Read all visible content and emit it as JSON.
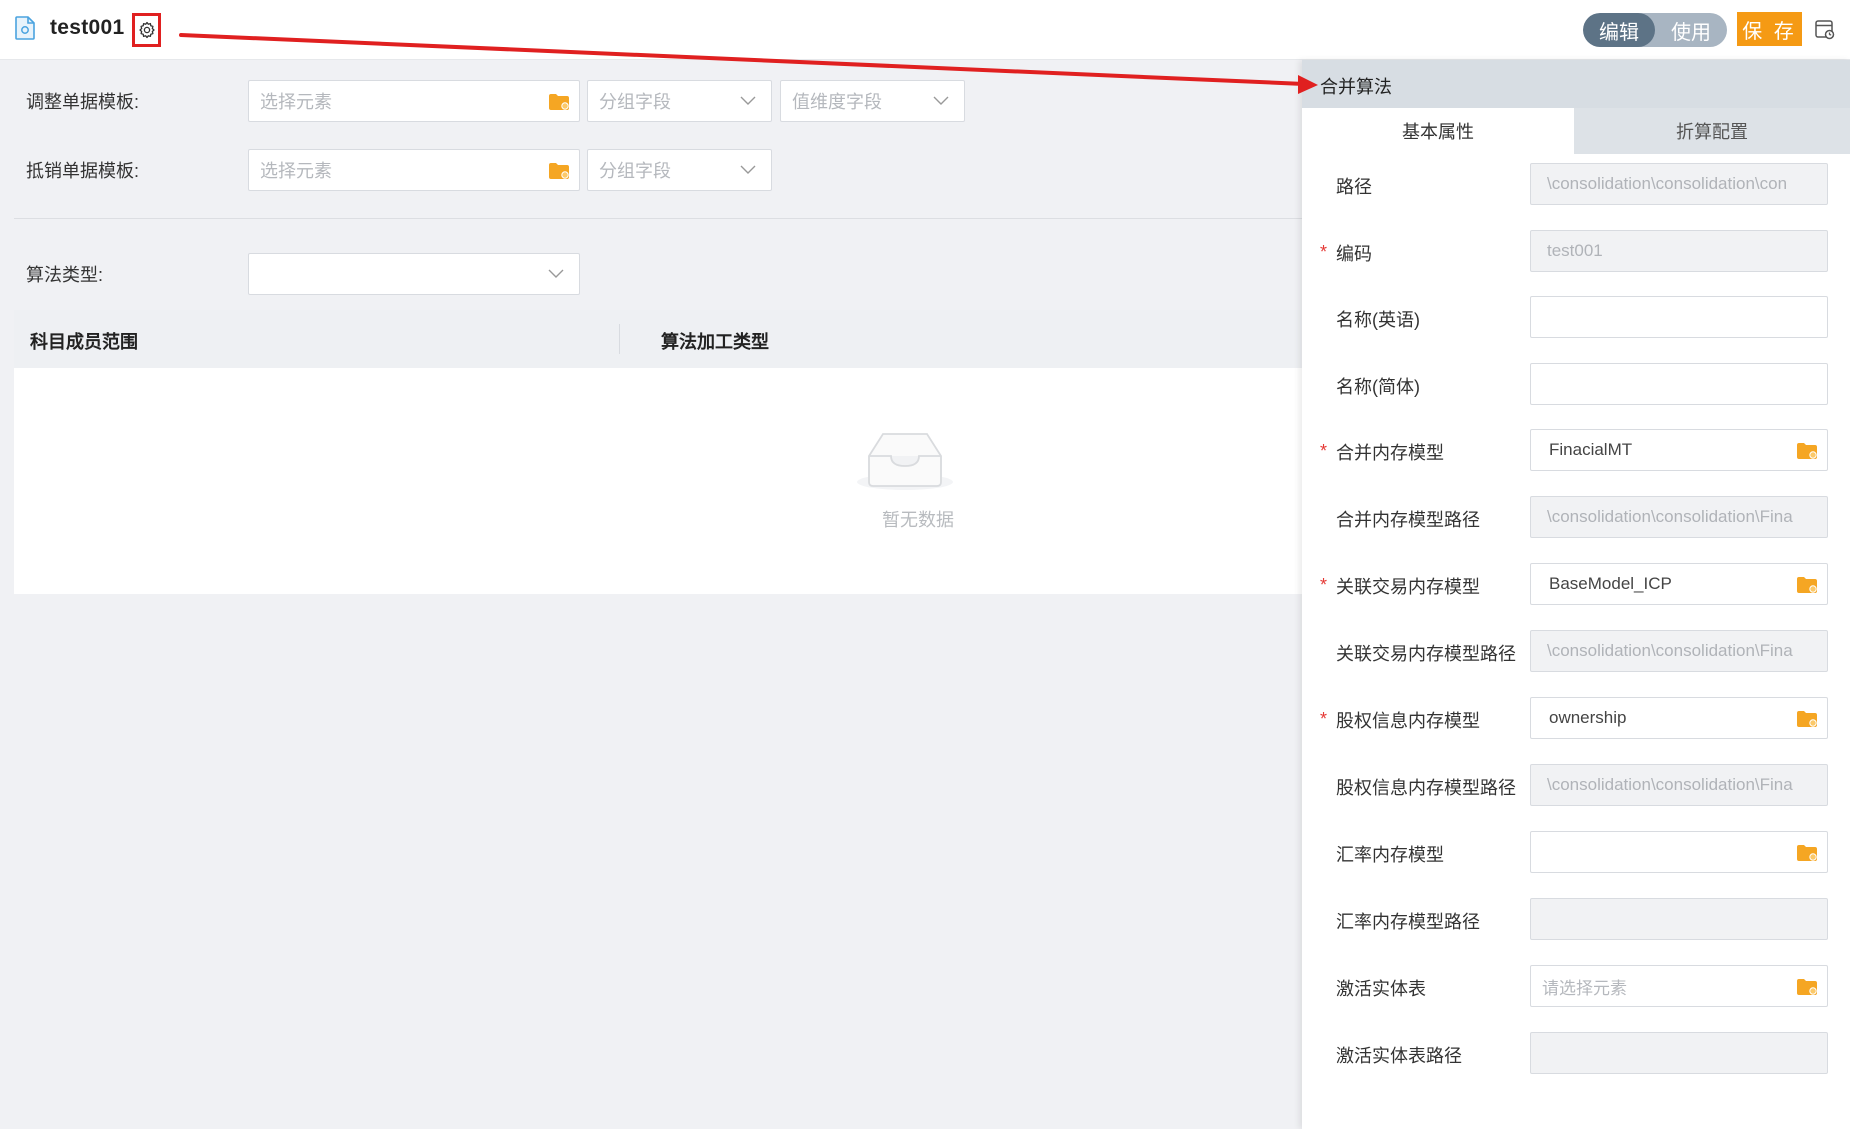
{
  "header": {
    "title": "test001",
    "mode_edit": "编辑",
    "mode_use": "使用",
    "save_label": "保 存"
  },
  "form": {
    "adjust_label": "调整单据模板:",
    "adjust_select_placeholder": "选择元素",
    "adjust_group_placeholder": "分组字段",
    "adjust_value_placeholder": "值维度字段",
    "offset_label": "抵销单据模板:",
    "offset_select_placeholder": "选择元素",
    "offset_group_placeholder": "分组字段",
    "algo_type_label": "算法类型:",
    "algo_type_value": ""
  },
  "table": {
    "columns": [
      "科目成员范围",
      "算法加工类型"
    ],
    "empty_text": "暂无数据"
  },
  "panel": {
    "title": "合并算法",
    "tabs": [
      "基本属性",
      "折算配置"
    ],
    "fields": [
      {
        "label": "路径",
        "value": "\\consolidation\\consolidation\\con",
        "required": false
      },
      {
        "label": "编码",
        "value": "test001",
        "required": true
      },
      {
        "label": "名称(英语)",
        "value": "",
        "required": false
      },
      {
        "label": "名称(简体)",
        "value": "",
        "required": false
      },
      {
        "label": "合并内存模型",
        "value": "FinacialMT",
        "required": true
      },
      {
        "label": "合并内存模型路径",
        "value": "\\consolidation\\consolidation\\Fina",
        "required": false
      },
      {
        "label": "关联交易内存模型",
        "value": "BaseModel_ICP",
        "required": true
      },
      {
        "label": "关联交易内存模型路径",
        "value": "\\consolidation\\consolidation\\Fina",
        "required": false
      },
      {
        "label": "股权信息内存模型",
        "value": "ownership",
        "required": true
      },
      {
        "label": "股权信息内存模型路径",
        "value": "\\consolidation\\consolidation\\Fina",
        "required": false
      },
      {
        "label": "汇率内存模型",
        "value": "",
        "required": false
      },
      {
        "label": "汇率内存模型路径",
        "value": "",
        "required": false
      },
      {
        "label": "激活实体表",
        "value": "请选择元素",
        "required": false
      },
      {
        "label": "激活实体表路径",
        "value": "",
        "required": false
      }
    ],
    "required_mark": "*"
  },
  "colors": {
    "accent_orange": "#f59a14",
    "toggle_active": "#5d7386",
    "annotation_red": "#e02020",
    "folder_icon": "#f5a623"
  },
  "icons": [
    "document-icon",
    "gear-icon",
    "folder-icon",
    "chevron-down-icon",
    "empty-inbox-icon",
    "layout-icon"
  ]
}
